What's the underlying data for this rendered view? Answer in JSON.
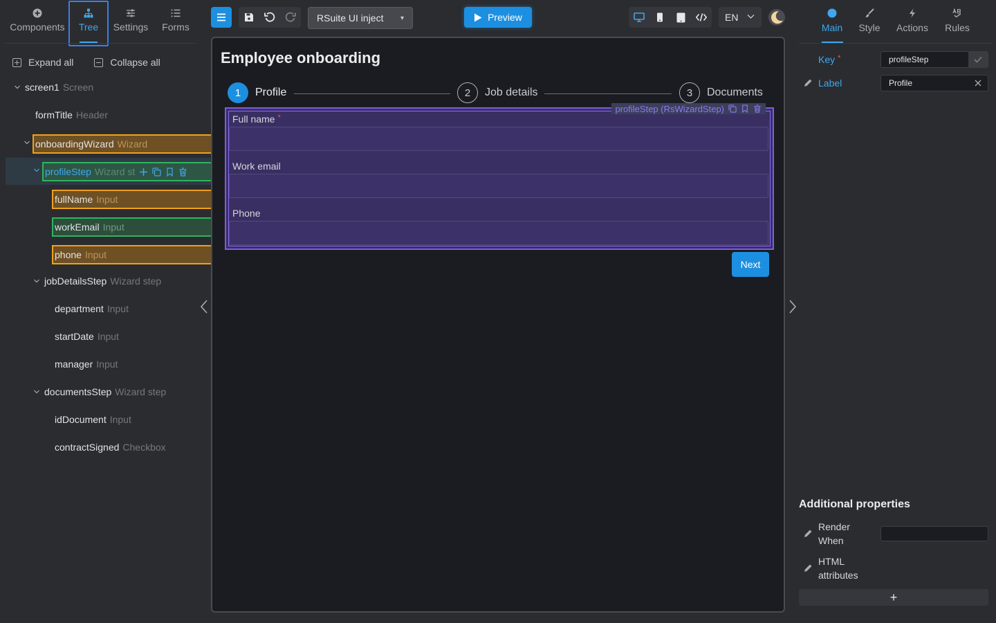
{
  "left_tabs": [
    {
      "label": "Components",
      "icon": "components-icon"
    },
    {
      "label": "Tree",
      "icon": "tree-icon"
    },
    {
      "label": "Settings",
      "icon": "settings-sliders-icon"
    },
    {
      "label": "Forms",
      "icon": "list-icon"
    }
  ],
  "tree_actions": {
    "expand_all": "Expand all",
    "collapse_all": "Collapse all"
  },
  "tree": [
    {
      "name": "screen1",
      "type": "Screen"
    },
    {
      "name": "formTitle",
      "type": "Header"
    },
    {
      "name": "onboardingWizard",
      "type": "Wizard"
    },
    {
      "name": "profileStep",
      "type": "Wizard st"
    },
    {
      "name": "fullName",
      "type": "Input"
    },
    {
      "name": "workEmail",
      "type": "Input"
    },
    {
      "name": "phone",
      "type": "Input"
    },
    {
      "name": "jobDetailsStep",
      "type": "Wizard step"
    },
    {
      "name": "department",
      "type": "Input"
    },
    {
      "name": "startDate",
      "type": "Input"
    },
    {
      "name": "manager",
      "type": "Input"
    },
    {
      "name": "documentsStep",
      "type": "Wizard step"
    },
    {
      "name": "idDocument",
      "type": "Input"
    },
    {
      "name": "contractSigned",
      "type": "Checkbox"
    }
  ],
  "toolbar": {
    "project": "RSuite UI inject",
    "preview": "Preview",
    "language": "EN"
  },
  "canvas": {
    "title": "Employee onboarding",
    "steps": [
      {
        "num": "1",
        "label": "Profile"
      },
      {
        "num": "2",
        "label": "Job details"
      },
      {
        "num": "3",
        "label": "Documents"
      }
    ],
    "selection_badge": "profileStep (RsWizardStep)",
    "fields": [
      {
        "label": "Full name",
        "required": "*"
      },
      {
        "label": "Work email"
      },
      {
        "label": "Phone"
      }
    ],
    "next_button": "Next"
  },
  "right_tabs": [
    {
      "label": "Main",
      "icon": "circle-dot-icon"
    },
    {
      "label": "Style",
      "icon": "brush-icon"
    },
    {
      "label": "Actions",
      "icon": "lightning-icon"
    },
    {
      "label": "Rules",
      "icon": "rules-icon"
    }
  ],
  "props": {
    "key_label": "Key",
    "key_required": "*",
    "key_value": "profileStep",
    "label_label": "Label",
    "label_value": "Profile"
  },
  "additional": {
    "title": "Additional properties",
    "render_when": "Render When",
    "html_attributes": "HTML attributes",
    "add_button": "+"
  },
  "colors": {
    "accent": "#1d8fe0",
    "selection_purple": "#7b5ce6",
    "highlight_orange": "#f0a11e",
    "highlight_green": "#2fb55f"
  }
}
